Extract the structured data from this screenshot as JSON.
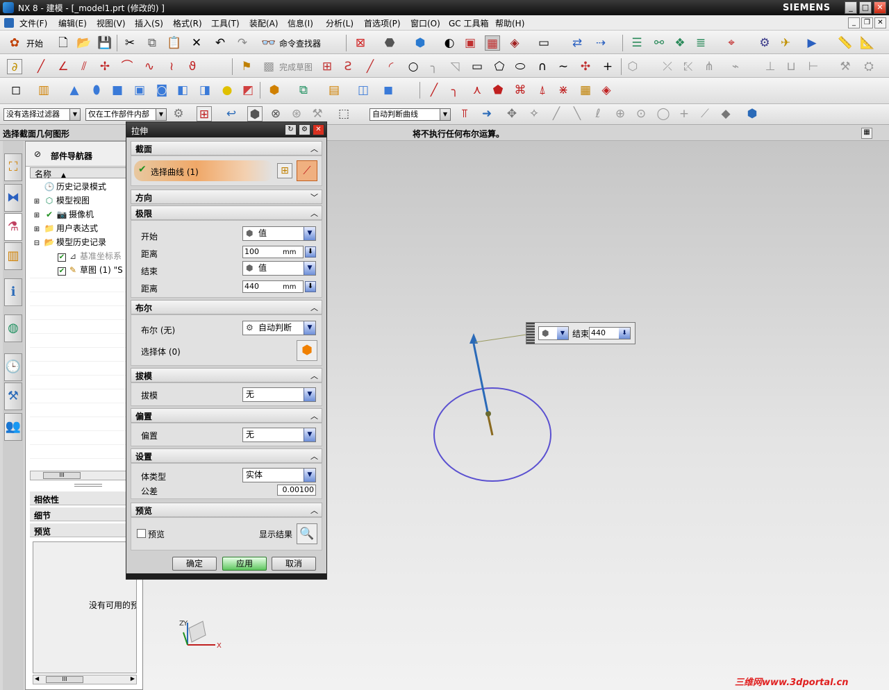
{
  "window": {
    "title": "NX 8 - 建模 - [_model1.prt  (修改的) ]",
    "brand": "SIEMENS",
    "controls": [
      "_",
      "□",
      "✕"
    ]
  },
  "menu": [
    "文件(F)",
    "编辑(E)",
    "视图(V)",
    "插入(S)",
    "格式(R)",
    "工具(T)",
    "装配(A)",
    "信息(I)",
    "分析(L)",
    "首选项(P)",
    "窗口(O)",
    "GC 工具箱",
    "帮助(H)"
  ],
  "toolbar": {
    "start_label": "开始",
    "command_finder": "命令查找器",
    "finish_sketch": "完成草图"
  },
  "selection": {
    "filter": "没有选择过滤器",
    "scope": "仅在工作部件内部",
    "curve_rule": "自动判断曲线"
  },
  "cue": {
    "left": "选择截面几何图形",
    "center": "将不执行任何布尔运算。"
  },
  "navigator": {
    "title": "部件导航器",
    "column_name": "名称",
    "items": [
      {
        "label": "历史记录模式",
        "icon": "🕒",
        "dim": false
      },
      {
        "label": "模型视图",
        "icon": "⬡",
        "dim": false
      },
      {
        "label": "摄像机",
        "icon": "📷",
        "dim": false
      },
      {
        "label": "用户表达式",
        "icon": "📁",
        "dim": false
      },
      {
        "label": "模型历史记录",
        "icon": "📂",
        "dim": false
      },
      {
        "label": "基准坐标系",
        "icon": "⊿",
        "dim": true
      },
      {
        "label": "草图 (1) \"S",
        "icon": "✎",
        "dim": false
      }
    ],
    "panels": [
      "相依性",
      "细节",
      "预览"
    ],
    "preview_empty": "没有可用的预"
  },
  "dialog": {
    "title": "拉伸",
    "sections": {
      "section": "截面",
      "direction": "方向",
      "limits": "极限",
      "boolean": "布尔",
      "draft": "拔模",
      "offset": "偏置",
      "settings": "设置",
      "preview": "预览"
    },
    "select_curve": "选择曲线 (1)",
    "start_label": "开始",
    "start_value": "值",
    "start_distance_label": "距离",
    "start_distance": "100",
    "end_label": "结束",
    "end_value": "值",
    "end_distance_label": "距离",
    "end_distance": "440",
    "unit": "mm",
    "boolean_label": "布尔 (无)",
    "boolean_value": "自动判断",
    "select_body": "选择体 (0)",
    "draft_label": "拔模",
    "draft_value": "无",
    "offset_label": "偏置",
    "offset_value": "无",
    "body_type_label": "体类型",
    "body_type_value": "实体",
    "tolerance_label": "公差",
    "tolerance_value": "0.00100",
    "preview_label": "预览",
    "show_result": "显示结果",
    "ok": "确定",
    "apply": "应用",
    "cancel": "取消"
  },
  "onscreen": {
    "end_label": "结束",
    "end_value": "440"
  },
  "triad": {
    "x": "X",
    "y": "Y",
    "z": "Z"
  },
  "watermark": "三维网www.3dportal.cn",
  "colors": {
    "circle": "#5a50d0",
    "vector": "#2a6ab8",
    "apply": "#5fc65f"
  }
}
